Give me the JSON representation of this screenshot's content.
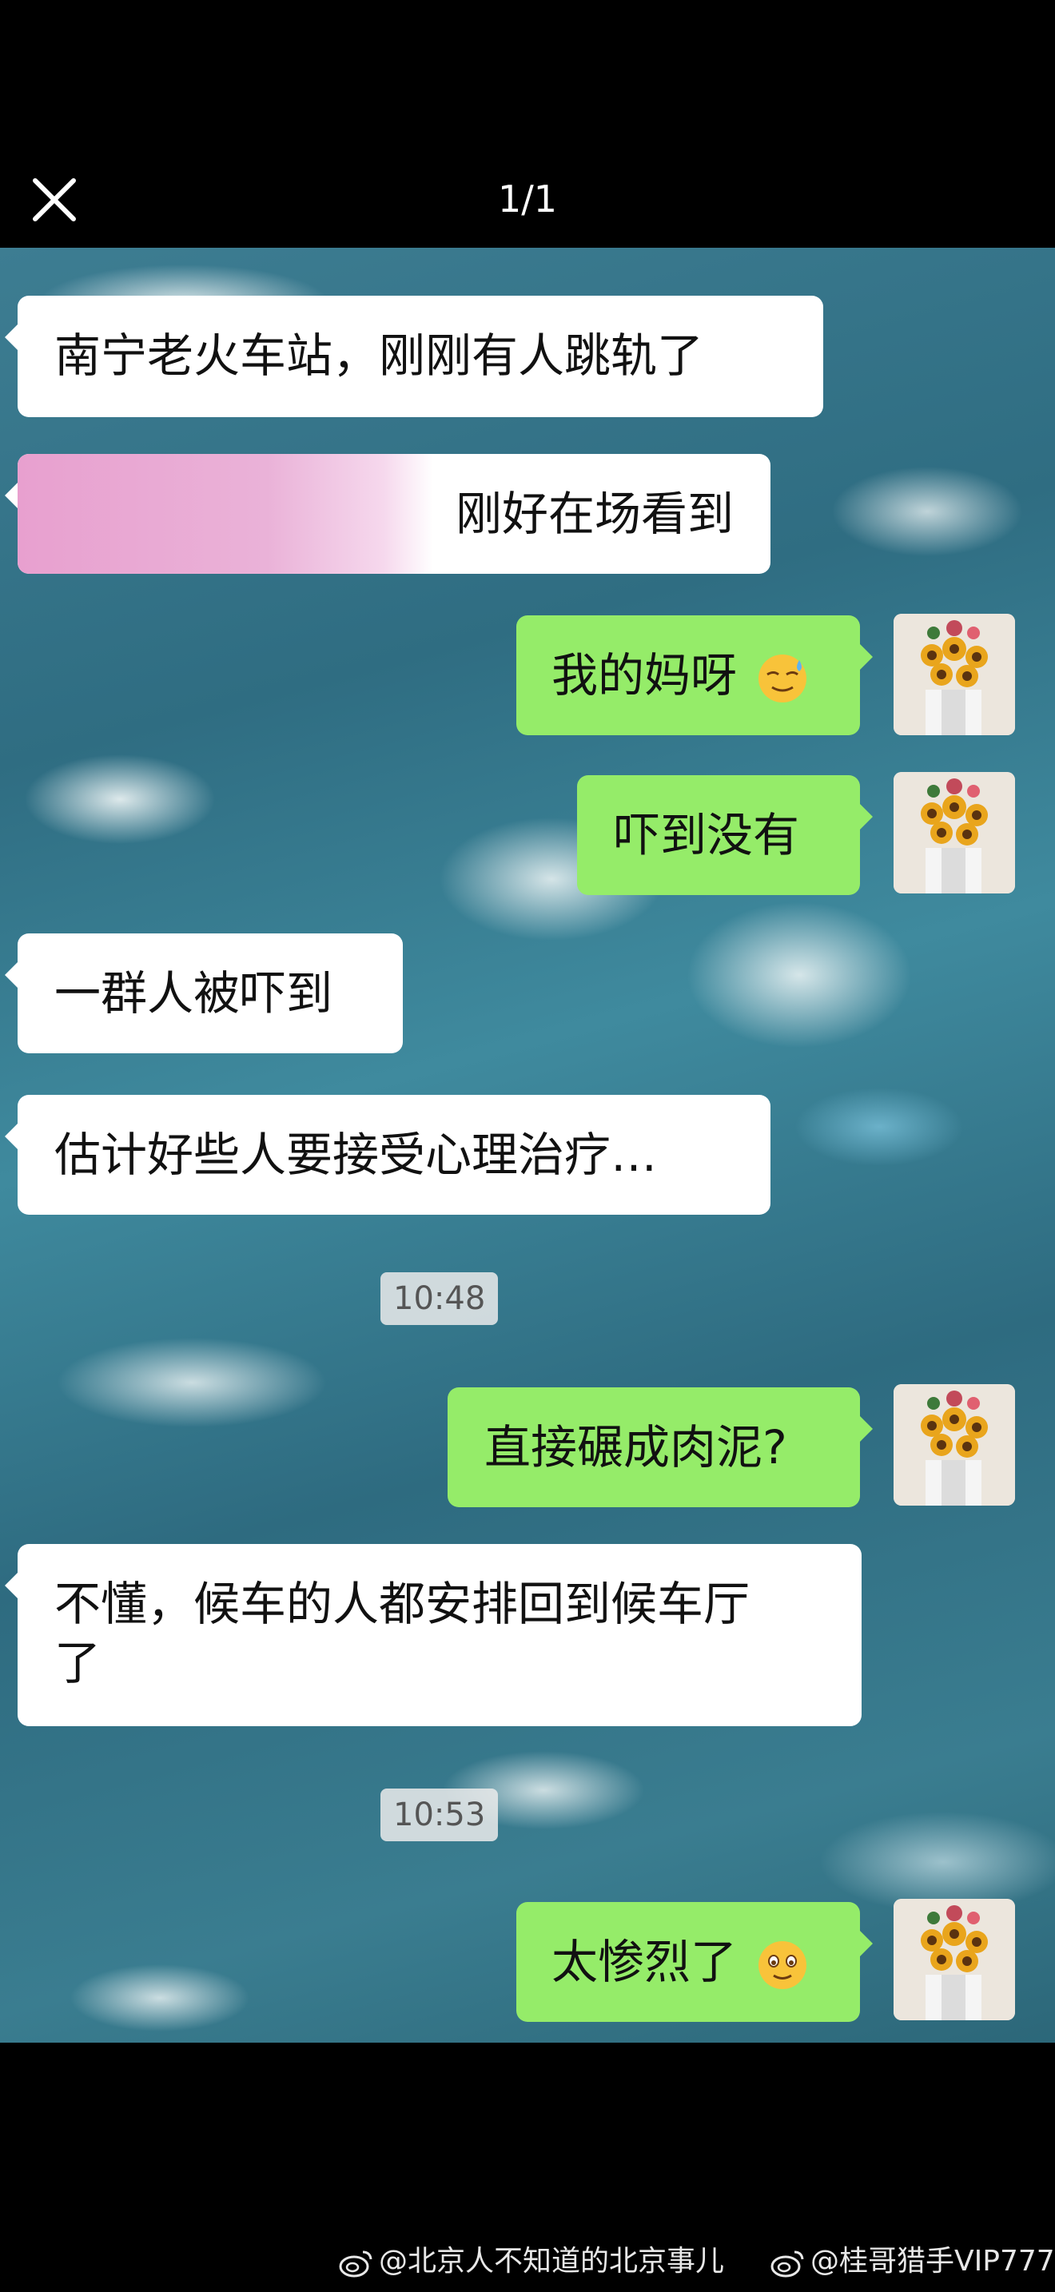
{
  "header": {
    "counter": "1/1",
    "close_icon": "close-icon"
  },
  "messages": [
    {
      "side": "left",
      "text": "南宁老火车站，刚刚有人跳轨了"
    },
    {
      "side": "left",
      "text": "刚好在场看到",
      "partially_obscured": true
    },
    {
      "side": "right",
      "text": "我的妈呀",
      "emoji": "sweat-smile-emoji"
    },
    {
      "side": "right",
      "text": "吓到没有"
    },
    {
      "side": "left",
      "text": "一群人被吓到"
    },
    {
      "side": "left",
      "text": "估计好些人要接受心理治疗…"
    },
    {
      "side": "right",
      "text": "直接碾成肉泥?"
    },
    {
      "side": "left",
      "line1": "不懂，候车的人都安排回到候车厅",
      "line2": "了"
    },
    {
      "side": "right",
      "text": "太惨烈了",
      "emoji": "sad-smile-emoji"
    }
  ],
  "timestamps": [
    "10:48",
    "10:53"
  ],
  "credits": [
    "@北京人不知道的北京事儿",
    "@桂哥猎手VIP777"
  ],
  "colors": {
    "left_bubble": "#ffffff",
    "right_bubble": "#95ec69",
    "background": "#000000",
    "water": "#2f6d82"
  }
}
